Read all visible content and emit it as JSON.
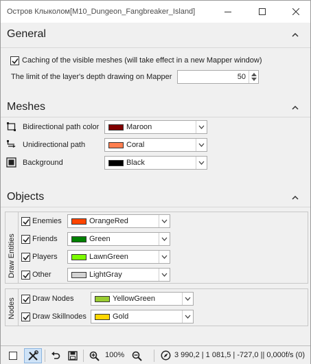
{
  "window": {
    "title": "Остров Клыколом[M10_Dungeon_Fangbreaker_Island]"
  },
  "general": {
    "heading": "General",
    "caching_label": "Caching of the visible meshes (will take effect in a new Mapper window)",
    "caching_checked": true,
    "depth_label": "The limit of the layer's depth drawing on Mapper",
    "depth_value": "50"
  },
  "meshes": {
    "heading": "Meshes",
    "rows": [
      {
        "label": "Bidirectional path color",
        "color_name": "Maroon",
        "color": "#800000",
        "icon": "bidirectional-path-icon"
      },
      {
        "label": "Unidirectional path",
        "color_name": "Coral",
        "color": "#ff7f50",
        "icon": "unidirectional-path-icon"
      },
      {
        "label": "Background",
        "color_name": "Black",
        "color": "#000000",
        "icon": "background-icon"
      }
    ]
  },
  "objects": {
    "heading": "Objects",
    "entities_group": "Draw Entities",
    "entities": [
      {
        "label": "Enemies",
        "checked": true,
        "color_name": "OrangeRed",
        "color": "#ff4500"
      },
      {
        "label": "Friends",
        "checked": true,
        "color_name": "Green",
        "color": "#008000"
      },
      {
        "label": "Players",
        "checked": true,
        "color_name": "LawnGreen",
        "color": "#7cfc00"
      },
      {
        "label": "Other",
        "checked": true,
        "color_name": "LightGray",
        "color": "#d3d3d3"
      }
    ],
    "nodes_group": "Nodes",
    "nodes": [
      {
        "label": "Draw Nodes",
        "checked": true,
        "color_name": "YellowGreen",
        "color": "#9acd32"
      },
      {
        "label": "Draw Skillnodes",
        "checked": true,
        "color_name": "Gold",
        "color": "#ffd700"
      }
    ]
  },
  "statusbar": {
    "zoom": "100%",
    "coords": "3 990,2 | 1 081,5 | -727,0 || 0,000f/s (0)"
  }
}
